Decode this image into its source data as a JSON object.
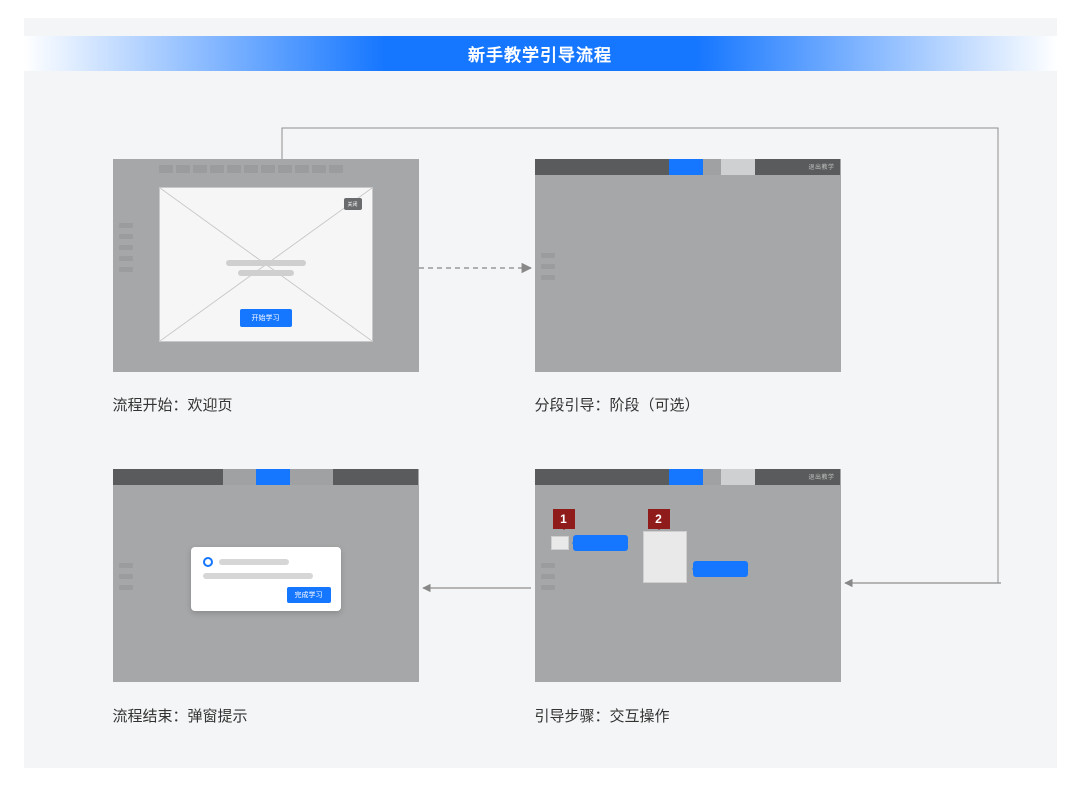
{
  "title": "新手教学引导流程",
  "panels": {
    "welcome": {
      "caption": "流程开始：欢迎页",
      "close_badge": "关闭",
      "start_button": "开始学习"
    },
    "phase": {
      "caption": "分段引导：阶段（可选）",
      "exit_label": "退出教学"
    },
    "steps": {
      "caption": "引导步骤：交互操作",
      "exit_label": "退出教学",
      "marker1": "1",
      "marker2": "2"
    },
    "end": {
      "caption": "流程结束：弹窗提示",
      "done_button": "完成学习"
    }
  },
  "colors": {
    "accent": "#1576ff",
    "marker": "#8f1b1b",
    "panel_bg": "#a6a7a8"
  }
}
